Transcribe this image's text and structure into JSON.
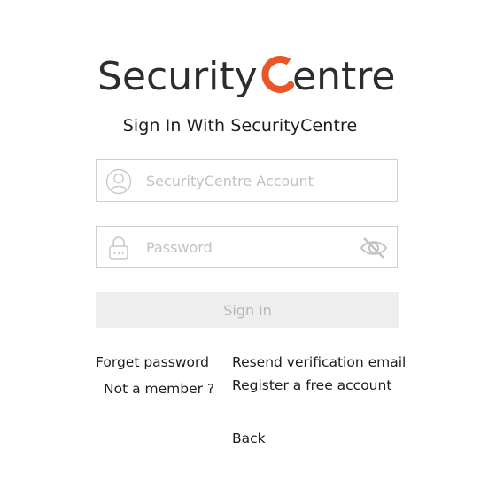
{
  "logo": {
    "text_part1": "Security",
    "text_part2": "entre",
    "brand_orange": "#e8572a",
    "brand_dark": "#2d2d2d"
  },
  "heading": "Sign In With SecurityCentre",
  "account_field": {
    "placeholder": "SecurityCentre Account",
    "value": "",
    "icon": "user-icon"
  },
  "password_field": {
    "placeholder": "Password",
    "value": "",
    "icon": "lock-icon",
    "toggle_icon": "eye-off-icon"
  },
  "signin_button": "Sign in",
  "links": {
    "forget_password": "Forget password",
    "resend_verification": "Resend verification email",
    "not_a_member": "Not a member ?",
    "register": "Register a free account",
    "back": "Back"
  }
}
